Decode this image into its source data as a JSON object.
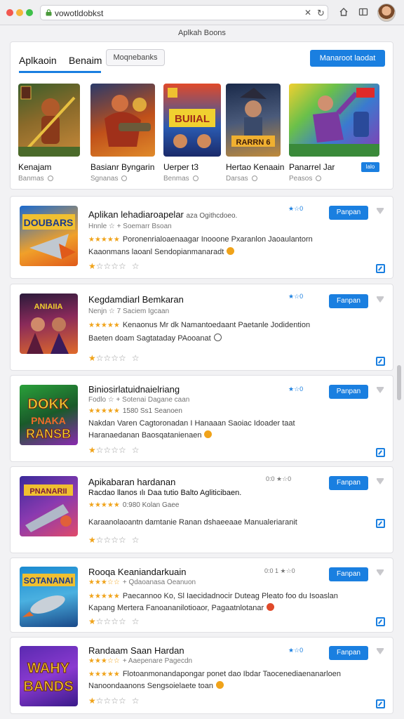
{
  "browser": {
    "url": "vowotldobkst",
    "colors": {
      "close": "#f2574f",
      "minimize": "#f5b53a",
      "maximize": "#3ec04a"
    }
  },
  "page": {
    "title": "Aplkah Boons"
  },
  "featured": {
    "tabs": [
      {
        "label": "Aplkaoin"
      },
      {
        "label": "Benaim"
      }
    ],
    "pill_label": "Moqnebanks",
    "action_label": "Manaroot  laodat",
    "badge_label": "lalo",
    "items": [
      {
        "name": "Kenajam",
        "sub": "Banmas"
      },
      {
        "name": "Basianr Byngarin",
        "sub": "Sgnanas"
      },
      {
        "name": "Uerper t3",
        "sub": "Benmas"
      },
      {
        "name": "Hertao Kenaain",
        "sub": "Darsas"
      },
      {
        "name": "Panarrel Jar",
        "sub": "Peasos"
      }
    ]
  },
  "apps": [
    {
      "title": "Aplikan lehadiaroapelar",
      "title_extra": "aza  Ogithcdoeo.",
      "meta": "Hnnle  ☆  +  Soemarr Bsoan",
      "desc1": "Poronenrialoaenaagar Inooone Pxaranlon Jaoaulantorn",
      "desc2": "Kaaonmans laoanl Sendopianmanaradt",
      "score": "★☆0",
      "button": "Panpan",
      "rating": 1
    },
    {
      "title": "Kegdamdiarl Bemkaran",
      "meta": "Nenjn  ☆  7  Saciem Igcaan",
      "desc1": "Kenaonus Mr dk Namantoedaant  Paetanle Jodidention",
      "desc2": "Baeten doam  Sagtataday PAooanat",
      "score": "★☆0",
      "button": "Fanpan",
      "rating": 1
    },
    {
      "title": "Biniosirlatuidnaielriang",
      "meta": "Fodlo  ☆  +  Sotenai Dagane caan",
      "desc1": "Nakdan Varen  Cagtoronadan I Hanaaan  Saoiac Idoader taat",
      "desc2": "Haranaedanan  Baosqatanienaen",
      "score": "★☆0",
      "button": "Panpan",
      "rating": 1
    },
    {
      "title": "Apikabaran hardanan",
      "title2": "Racdao llanos ılı Daa tutio Balto Agliticibaen.",
      "meta": "0:980 Kolan Gaee",
      "desc1": "Karaanolaoantn damtanie Ranan dshaeeaae  Manualeriaranit",
      "score": "0:0  ★☆0",
      "button": "Fanpan",
      "rating": 1
    },
    {
      "title": "Rooqa Keaniandarkuain",
      "meta": "+  Qdaoanasa  Oeanuon",
      "desc1": "Paecannoo Ko, Sl Iaecidadnocir Duteag  Pleato foo du Isoaslan",
      "desc2": "Kapang  Mertera Fanoananilotioaor, Pagaatnlotanar",
      "score": "0:0 1 ★☆0",
      "button": "Fanpan",
      "rating": 1
    },
    {
      "title": "Randaam Saan Hardan",
      "meta": "+  Aaepenare  Pagecdn",
      "desc1": "Flotoanmonandapongar ponet dao Ibdar Taocenediaenanarloen",
      "desc2": "Nanoondaanons  Sengsoielaete toan",
      "score": "★☆0",
      "button": "Fanpan",
      "rating": 1
    }
  ]
}
